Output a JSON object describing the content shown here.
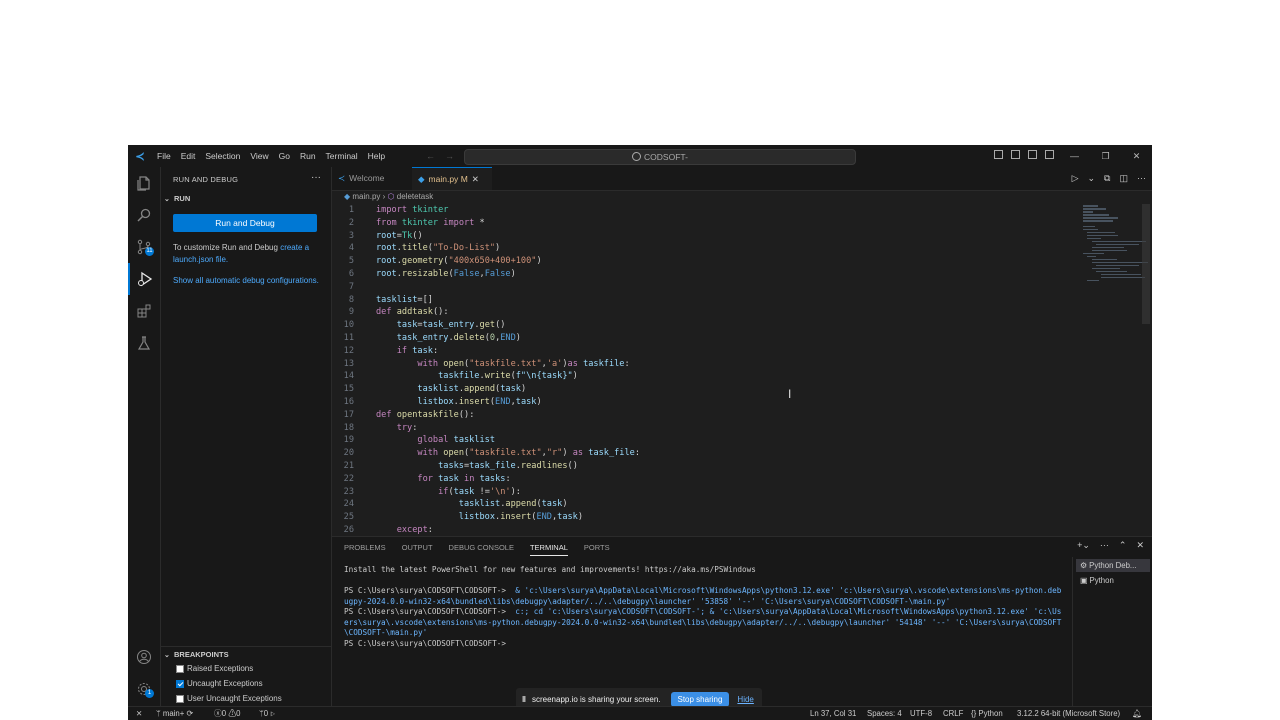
{
  "title_bar": {
    "menu": [
      "File",
      "Edit",
      "Selection",
      "View",
      "Go",
      "Run",
      "Terminal",
      "Help"
    ],
    "command_center": "CODSOFT-"
  },
  "activity_bar": {
    "icons": [
      "explorer-icon",
      "search-icon",
      "source-control-icon",
      "run-debug-icon",
      "extensions-icon",
      "testing-icon",
      "account-icon",
      "manage-icon"
    ],
    "source_control_badge": "11",
    "manage_badge": "1"
  },
  "sidebar": {
    "title": "RUN AND DEBUG",
    "run_section": "RUN",
    "run_button": "Run and Debug",
    "customize_text": "To customize Run and Debug",
    "customize_link": "create a launch.json file.",
    "show_all_link": "Show all automatic debug configurations.",
    "breakpoints_section": "BREAKPOINTS",
    "breakpoints": [
      {
        "label": "Raised Exceptions",
        "checked": false
      },
      {
        "label": "Uncaught Exceptions",
        "checked": true
      },
      {
        "label": "User Uncaught Exceptions",
        "checked": false
      }
    ]
  },
  "tabs": [
    {
      "label": "Welcome"
    },
    {
      "label": "main.py",
      "status": "M"
    }
  ],
  "breadcrumb": {
    "file": "main.py",
    "symbol": "deletetask"
  },
  "code_lines": [
    "import tkinter",
    "from tkinter import *",
    "root=Tk()",
    "root.title(\"To-Do-List\")",
    "root.geometry(\"400x650+400+100\")",
    "root.resizable(False,False)",
    "",
    "tasklist=[]",
    "def addtask():",
    "    task=task_entry.get()",
    "    task_entry.delete(0,END)",
    "    if task:",
    "        with open(\"taskfile.txt\",'a')as taskfile:",
    "            taskfile.write(f\"\\n{task}\")",
    "        tasklist.append(task)",
    "        listbox.insert(END,task)",
    "def opentaskfile():",
    "    try:",
    "        global tasklist",
    "        with open(\"taskfile.txt\",\"r\") as task_file:",
    "            tasks=task_file.readlines()",
    "        for task in tasks:",
    "            if(task !='\\n'):",
    "                tasklist.append(task)",
    "                listbox.insert(END,task)",
    "    except:"
  ],
  "panel": {
    "tabs": [
      "PROBLEMS",
      "OUTPUT",
      "DEBUG CONSOLE",
      "TERMINAL",
      "PORTS"
    ],
    "active_tab": "TERMINAL",
    "terminal": {
      "notice": "Install the latest PowerShell for new features and improvements! https://aka.ms/PSWindows",
      "run1_prompt": "PS C:\\Users\\surya\\CODSOFT\\CODSOFT-> ",
      "run1_cmd": " & 'c:\\Users\\surya\\AppData\\Local\\Microsoft\\WindowsApps\\python3.12.exe' 'c:\\Users\\surya\\.vscode\\extensions\\ms-python.debugpy-2024.0.0-win32-x64\\bundled\\libs\\debugpy\\adapter/../..\\debugpy\\launcher' '53858' '--' 'C:\\Users\\surya\\CODSOFT\\CODSOFT-\\main.py'",
      "run2_prompt": "PS C:\\Users\\surya\\CODSOFT\\CODSOFT-> ",
      "run2_cmd": " c:; cd 'c:\\Users\\surya\\CODSOFT\\CODSOFT-'; & 'c:\\Users\\surya\\AppData\\Local\\Microsoft\\WindowsApps\\python3.12.exe' 'c:\\Users\\surya\\.vscode\\extensions\\ms-python.debugpy-2024.0.0-win32-x64\\bundled\\libs\\debugpy\\adapter/../..\\debugpy\\launcher' '54148' '--' 'C:\\Users\\surya\\CODSOFT\\CODSOFT-\\main.py'",
      "final_prompt": "PS C:\\Users\\surya\\CODSOFT\\CODSOFT-> "
    },
    "terminal_list": [
      "Python Deb...",
      "Python"
    ]
  },
  "share_banner": {
    "text": "screenapp.io is sharing your screen.",
    "stop": "Stop sharing",
    "hide": "Hide"
  },
  "status_bar": {
    "branch": "main+",
    "errors": "0",
    "warnings": "0",
    "ports": "0",
    "position": "Ln 37, Col 31",
    "spaces": "Spaces: 4",
    "encoding": "UTF-8",
    "eol": "CRLF",
    "language": "Python",
    "interpreter": "3.12.2 64-bit (Microsoft Store)"
  }
}
